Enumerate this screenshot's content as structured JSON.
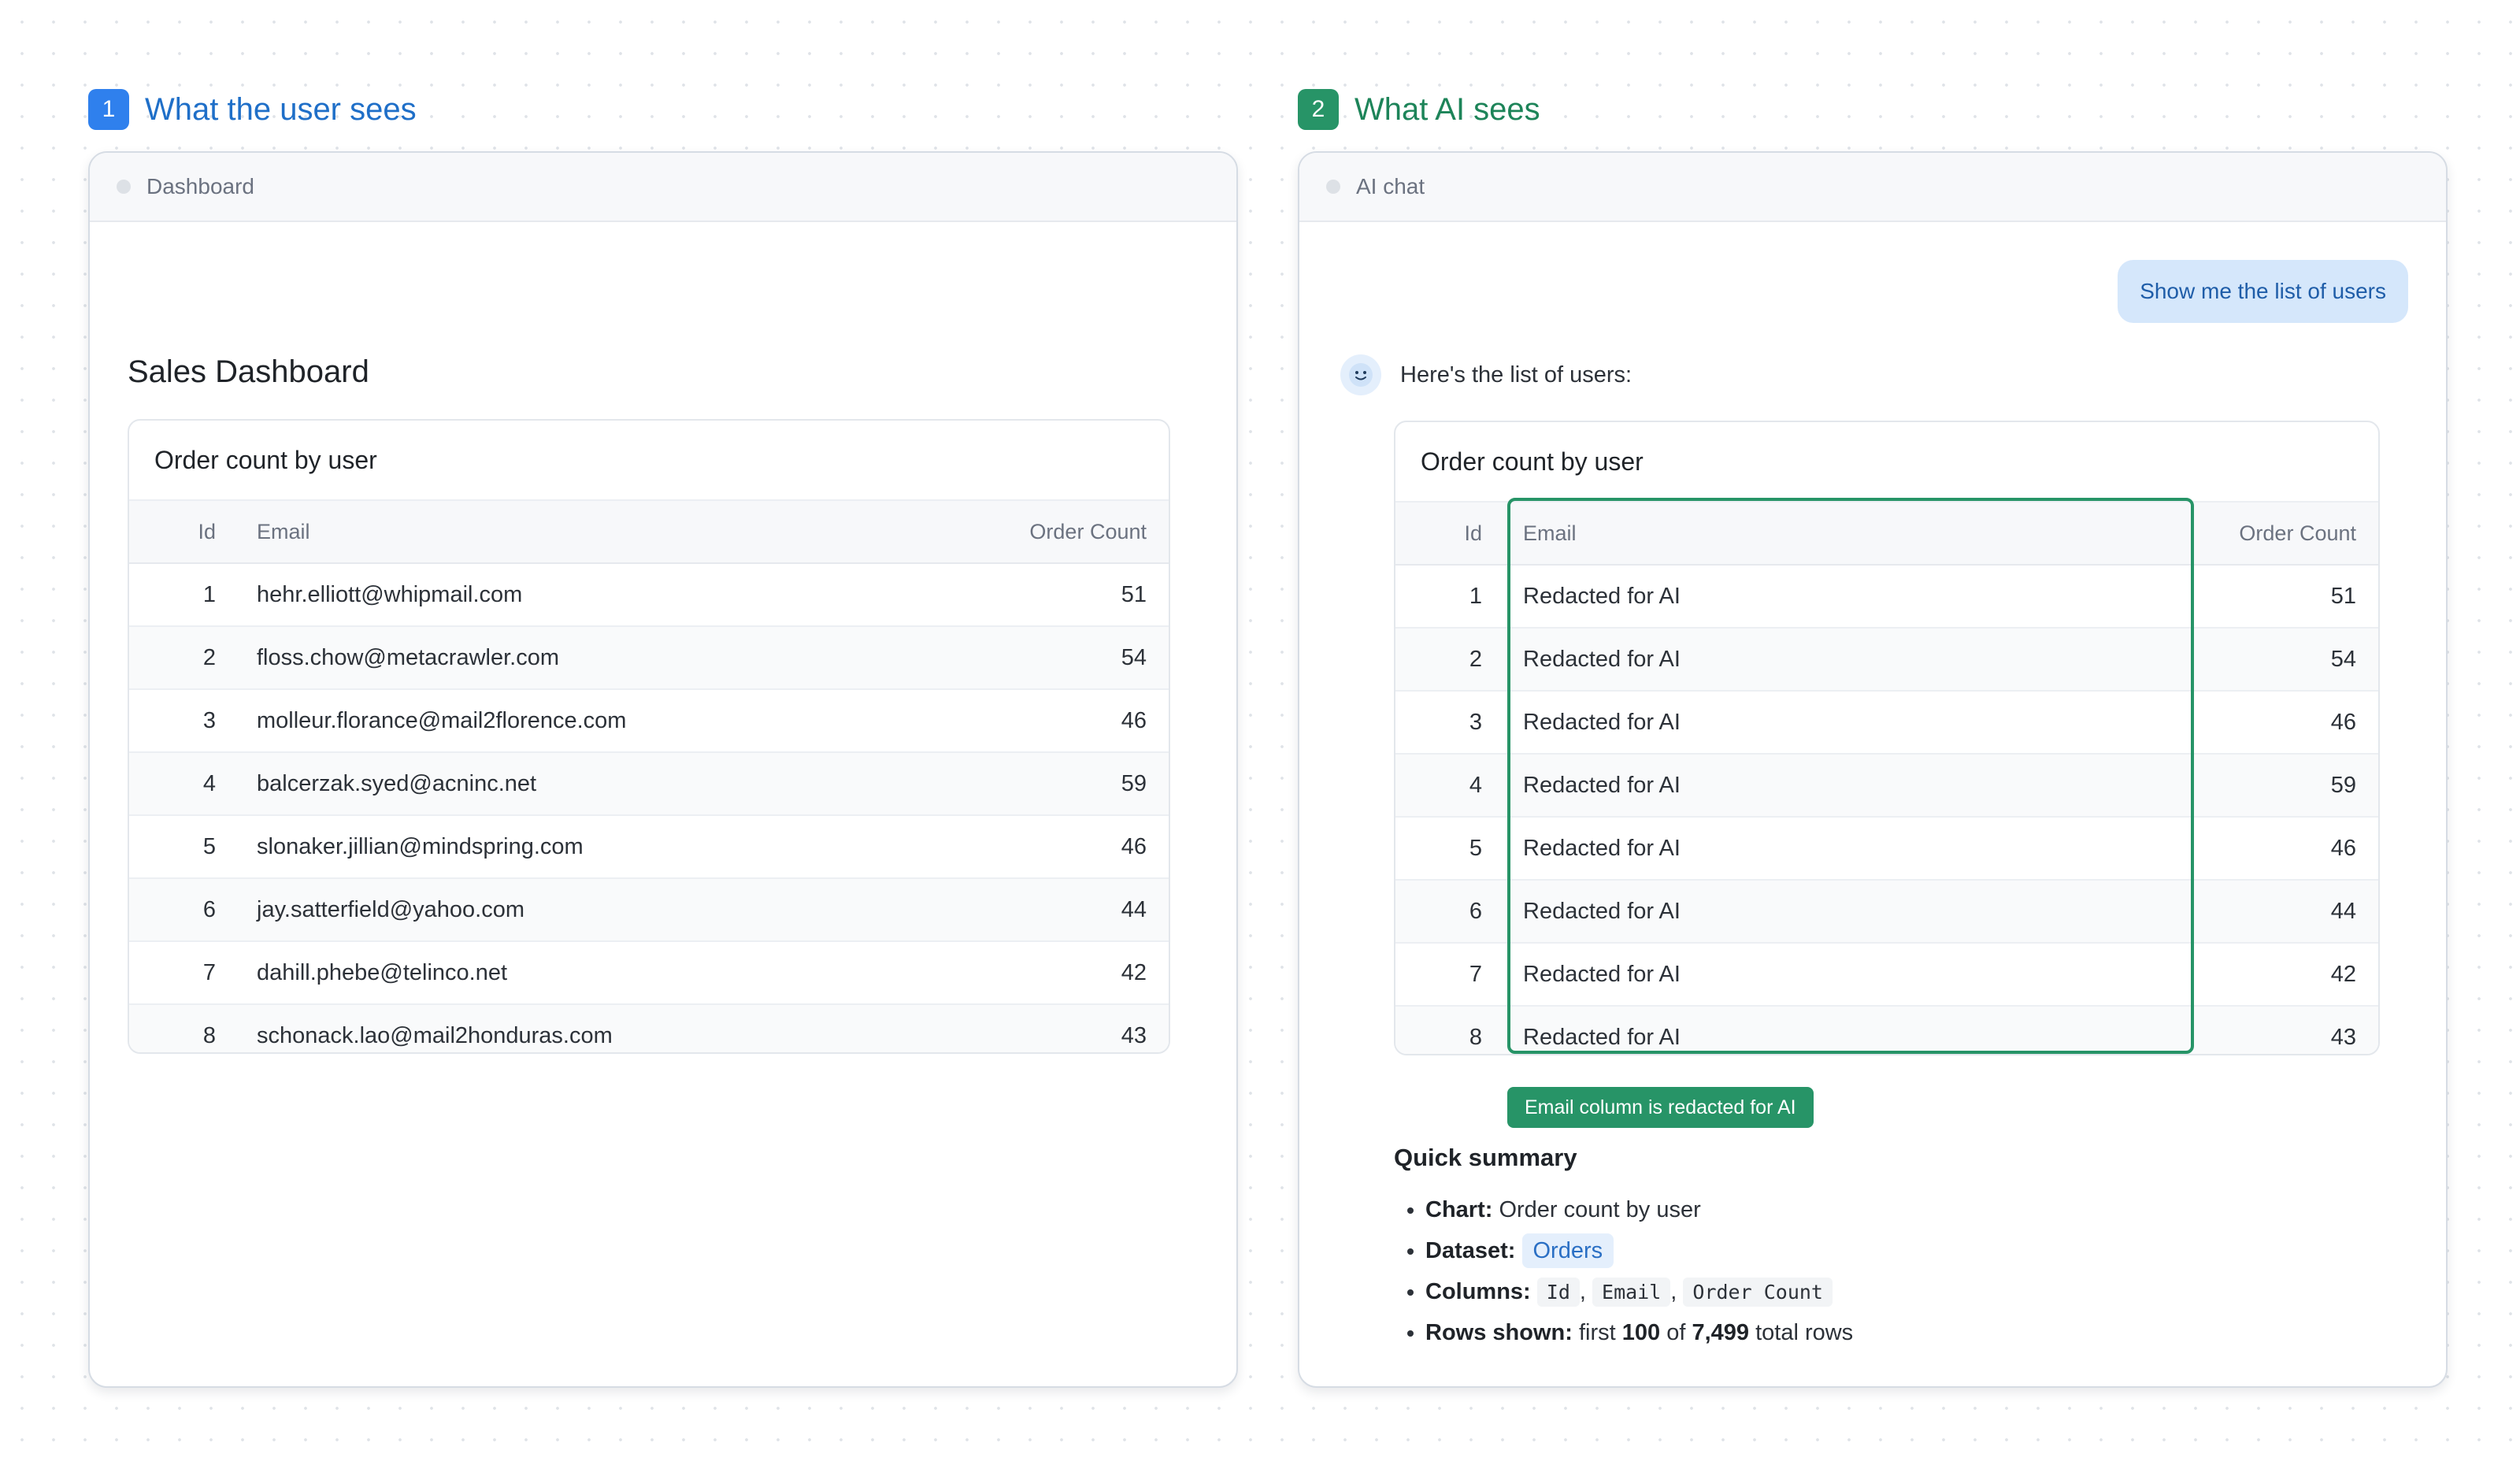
{
  "left": {
    "badge": "1",
    "heading": "What the user sees",
    "window_title": "Dashboard",
    "page_title": "Sales Dashboard",
    "card_title": "Order count by user",
    "columns": [
      "Id",
      "Email",
      "Order Count"
    ],
    "rows": [
      {
        "id": "1",
        "email": "hehr.elliott@whipmail.com",
        "count": "51"
      },
      {
        "id": "2",
        "email": "floss.chow@metacrawler.com",
        "count": "54"
      },
      {
        "id": "3",
        "email": "molleur.florance@mail2florence.com",
        "count": "46"
      },
      {
        "id": "4",
        "email": "balcerzak.syed@acninc.net",
        "count": "59"
      },
      {
        "id": "5",
        "email": "slonaker.jillian@mindspring.com",
        "count": "46"
      },
      {
        "id": "6",
        "email": "jay.satterfield@yahoo.com",
        "count": "44"
      },
      {
        "id": "7",
        "email": "dahill.phebe@telinco.net",
        "count": "42"
      },
      {
        "id": "8",
        "email": "schonack.lao@mail2honduras.com",
        "count": "43"
      }
    ]
  },
  "right": {
    "badge": "2",
    "heading": "What AI sees",
    "window_title": "AI chat",
    "user_message": "Show me the list of users",
    "bot_message": "Here's the list of users:",
    "card_title": "Order count by user",
    "columns": [
      "Id",
      "Email",
      "Order Count"
    ],
    "rows": [
      {
        "id": "1",
        "email": "Redacted for AI",
        "count": "51"
      },
      {
        "id": "2",
        "email": "Redacted for AI",
        "count": "54"
      },
      {
        "id": "3",
        "email": "Redacted for AI",
        "count": "46"
      },
      {
        "id": "4",
        "email": "Redacted for AI",
        "count": "59"
      },
      {
        "id": "5",
        "email": "Redacted for AI",
        "count": "46"
      },
      {
        "id": "6",
        "email": "Redacted for AI",
        "count": "44"
      },
      {
        "id": "7",
        "email": "Redacted for AI",
        "count": "42"
      },
      {
        "id": "8",
        "email": "Redacted for AI",
        "count": "43"
      }
    ],
    "redaction_tag": "Email column is redacted for AI",
    "summary": {
      "title": "Quick summary",
      "chart_label": "Chart:",
      "chart_value": "Order count by user",
      "dataset_label": "Dataset:",
      "dataset_value": "Orders",
      "columns_label": "Columns:",
      "columns_values": [
        "Id",
        "Email",
        "Order Count"
      ],
      "separator": ",",
      "rows_label": "Rows shown:",
      "rows_first_word": "first",
      "rows_shown": "100",
      "rows_of": "of",
      "rows_total": "7,499",
      "rows_suffix": "total rows"
    }
  },
  "colors": {
    "blue_accent": "#2f80ed",
    "green_accent": "#279467",
    "user_bubble": "#d5e7fb"
  }
}
